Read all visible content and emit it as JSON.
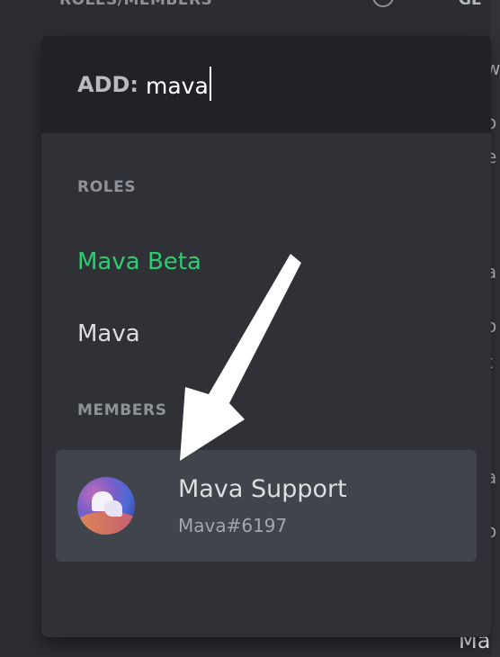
{
  "background": {
    "header": "ROLES/MEMBERS",
    "info_icon": "info-icon",
    "tab_fragment": "GE",
    "right_fragments": [
      "w",
      "o",
      "e",
      "a",
      "o",
      "t",
      "a",
      "o"
    ],
    "bottom_fragment": "Ma"
  },
  "popout": {
    "add_label": "ADD:",
    "search_value": "mava",
    "roles_header": "ROLES",
    "roles": [
      {
        "label": "Mava Beta",
        "color": "#2ecc71"
      },
      {
        "label": "Mava",
        "color": "#dcddde"
      }
    ],
    "members_header": "MEMBERS",
    "members": [
      {
        "name": "Mava Support",
        "tag": "Mava#6197",
        "avatar": "mava-avatar"
      }
    ]
  },
  "colors": {
    "popout_bg": "#2f3136",
    "search_bg": "#202225",
    "row_highlight": "#40444b",
    "accent_green": "#2ecc71"
  }
}
